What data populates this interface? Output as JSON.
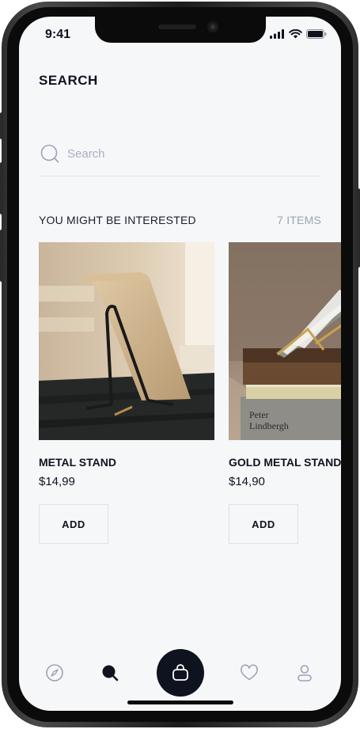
{
  "status_bar": {
    "time": "9:41"
  },
  "page": {
    "title": "SEARCH"
  },
  "search": {
    "placeholder": "Search",
    "value": ""
  },
  "section": {
    "title": "YOU MIGHT BE INTERESTED",
    "count": "7 ITEMS"
  },
  "products": [
    {
      "name": "METAL STAND",
      "price": "$14,99",
      "add_label": "ADD"
    },
    {
      "name": "GOLD METAL STAND",
      "price": "$14,90",
      "add_label": "ADD",
      "book_text": "Peter\nLindbergh"
    }
  ],
  "tabbar": {
    "items": [
      {
        "icon": "compass-icon",
        "active": false
      },
      {
        "icon": "search-icon",
        "active": true
      },
      {
        "icon": "bag-icon",
        "active": false
      },
      {
        "icon": "heart-icon",
        "active": false
      },
      {
        "icon": "user-icon",
        "active": false
      }
    ]
  },
  "colors": {
    "accent": "#0f1320",
    "background": "#f6f7f9",
    "muted": "#9aa3b6"
  }
}
